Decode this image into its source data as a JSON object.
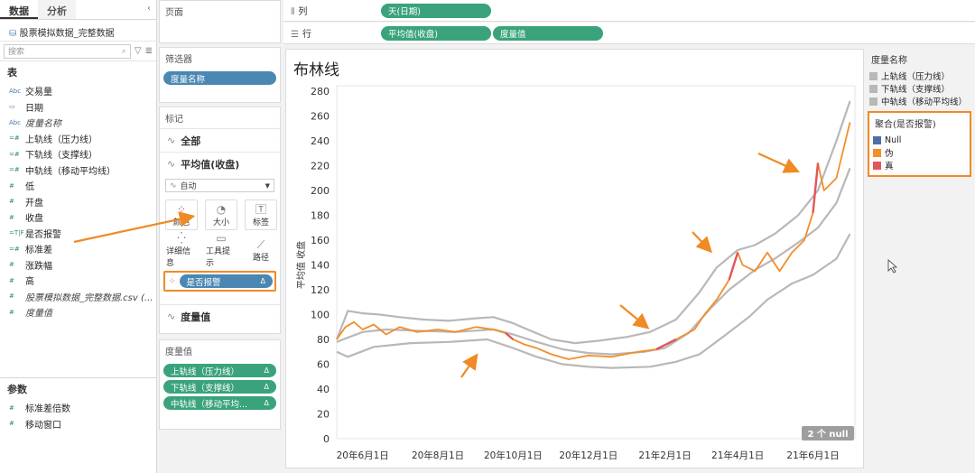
{
  "tabs": {
    "data": "数据",
    "analysis": "分析",
    "collapse": "‹"
  },
  "datasource": "股票模拟数据_完整数据",
  "search": {
    "placeholder": "搜索"
  },
  "tables_title": "表",
  "fields": [
    {
      "type": "Abc",
      "label": "交易量",
      "italic": false
    },
    {
      "type": "▭",
      "label": "日期",
      "italic": false
    },
    {
      "type": "Abc",
      "label": "度量名称",
      "italic": true
    },
    {
      "type": "=#",
      "label": "上轨线（压力线）",
      "italic": false
    },
    {
      "type": "=#",
      "label": "下轨线（支撑线）",
      "italic": false
    },
    {
      "type": "=#",
      "label": "中轨线（移动平均线）",
      "italic": false
    },
    {
      "type": "#",
      "label": "低",
      "italic": false
    },
    {
      "type": "#",
      "label": "开盘",
      "italic": false
    },
    {
      "type": "#",
      "label": "收盘",
      "italic": false
    },
    {
      "type": "=T|F",
      "label": "是否报警",
      "italic": false
    },
    {
      "type": "=#",
      "label": "标准差",
      "italic": false
    },
    {
      "type": "#",
      "label": "涨跌幅",
      "italic": false
    },
    {
      "type": "#",
      "label": "高",
      "italic": false
    },
    {
      "type": "#",
      "label": "股票模拟数据_完整数据.csv (...",
      "italic": true
    },
    {
      "type": "#",
      "label": "度量值",
      "italic": true
    }
  ],
  "params_title": "参数",
  "params": [
    {
      "type": "#",
      "label": "标准差倍数"
    },
    {
      "type": "#",
      "label": "移动窗口"
    }
  ],
  "cards": {
    "pages": "页面",
    "filters": "筛选器",
    "filter_pill": "度量名称",
    "marks": "标记",
    "all": "全部",
    "avg": "平均值(收盘)",
    "mark_type": "自动",
    "buttons": [
      "颜色",
      "大小",
      "标签",
      "详细信息",
      "工具提示",
      "路径"
    ],
    "color_pill": "是否报警",
    "measure_values_row": "度量值",
    "measure_values_title": "度量值",
    "mv_pills": [
      "上轨线（压力线）",
      "下轨线（支撑线）",
      "中轨线（移动平均..."
    ],
    "delta": "Δ"
  },
  "shelves": {
    "columns_label": "列",
    "columns_pills": [
      "天(日期)"
    ],
    "rows_label": "行",
    "rows_pills": [
      "平均值(收盘)",
      "度量值"
    ]
  },
  "sheet_title": "布林线",
  "null_badge": "2 个 null",
  "legends": {
    "measure_title": "度量名称",
    "measure_items": [
      {
        "label": "上轨线（压力线）",
        "color": "#b8b8b8"
      },
      {
        "label": "下轨线（支撑线）",
        "color": "#b8b8b8"
      },
      {
        "label": "中轨线（移动平均线）",
        "color": "#b8b8b8"
      }
    ],
    "alert_title": "聚合(是否报警)",
    "alert_items": [
      {
        "label": "Null",
        "color": "#4e6fa3"
      },
      {
        "label": "伪",
        "color": "#f28e2b"
      },
      {
        "label": "真",
        "color": "#e15759"
      }
    ]
  },
  "chart_data": {
    "type": "line",
    "ylabel": "平均值 收盘",
    "ylim": [
      0,
      280
    ],
    "yticks": [
      0,
      20,
      40,
      60,
      80,
      100,
      120,
      140,
      160,
      180,
      200,
      220,
      240,
      260,
      280
    ],
    "xticks": [
      "20年6月1日",
      "20年8月1日",
      "20年10月1日",
      "20年12月1日",
      "21年2月1日",
      "21年4月1日",
      "21年6月1日"
    ],
    "xlim": [
      "2020-05-11",
      "2021-07-05"
    ],
    "series": [
      {
        "name": "上轨线（压力线）",
        "color": "#b8b8b8",
        "points": [
          [
            "2020-05-11",
            80
          ],
          [
            "2020-05-20",
            103
          ],
          [
            "2020-06-01",
            101
          ],
          [
            "2020-06-15",
            100
          ],
          [
            "2020-07-01",
            98
          ],
          [
            "2020-07-20",
            96
          ],
          [
            "2020-08-10",
            95
          ],
          [
            "2020-09-01",
            97
          ],
          [
            "2020-09-15",
            98
          ],
          [
            "2020-10-01",
            93
          ],
          [
            "2020-10-15",
            87
          ],
          [
            "2020-11-01",
            80
          ],
          [
            "2020-11-20",
            77
          ],
          [
            "2020-12-10",
            79
          ],
          [
            "2021-01-01",
            82
          ],
          [
            "2021-01-20",
            86
          ],
          [
            "2021-02-10",
            96
          ],
          [
            "2021-03-01",
            118
          ],
          [
            "2021-03-15",
            138
          ],
          [
            "2021-04-01",
            152
          ],
          [
            "2021-04-15",
            156
          ],
          [
            "2021-05-01",
            165
          ],
          [
            "2021-05-20",
            180
          ],
          [
            "2021-06-05",
            200
          ],
          [
            "2021-06-20",
            240
          ],
          [
            "2021-07-01",
            272
          ]
        ]
      },
      {
        "name": "中轨线（移动平均线）",
        "color": "#b8b8b8",
        "points": [
          [
            "2020-05-11",
            78
          ],
          [
            "2020-06-01",
            86
          ],
          [
            "2020-06-20",
            88
          ],
          [
            "2020-07-15",
            87
          ],
          [
            "2020-08-15",
            86
          ],
          [
            "2020-09-15",
            88
          ],
          [
            "2020-10-01",
            84
          ],
          [
            "2020-10-20",
            78
          ],
          [
            "2020-11-10",
            72
          ],
          [
            "2020-12-01",
            69
          ],
          [
            "2020-12-20",
            68
          ],
          [
            "2021-01-15",
            70
          ],
          [
            "2021-02-01",
            73
          ],
          [
            "2021-02-20",
            85
          ],
          [
            "2021-03-10",
            105
          ],
          [
            "2021-03-25",
            120
          ],
          [
            "2021-04-15",
            136
          ],
          [
            "2021-05-01",
            145
          ],
          [
            "2021-05-20",
            158
          ],
          [
            "2021-06-05",
            170
          ],
          [
            "2021-06-20",
            190
          ],
          [
            "2021-07-01",
            218
          ]
        ]
      },
      {
        "name": "下轨线（支撑线）",
        "color": "#b8b8b8",
        "points": [
          [
            "2020-05-11",
            70
          ],
          [
            "2020-05-20",
            66
          ],
          [
            "2020-06-10",
            74
          ],
          [
            "2020-07-10",
            77
          ],
          [
            "2020-08-10",
            78
          ],
          [
            "2020-09-10",
            80
          ],
          [
            "2020-10-01",
            73
          ],
          [
            "2020-10-20",
            66
          ],
          [
            "2020-11-10",
            60
          ],
          [
            "2020-12-01",
            58
          ],
          [
            "2020-12-20",
            57
          ],
          [
            "2021-01-20",
            58
          ],
          [
            "2021-02-10",
            62
          ],
          [
            "2021-03-01",
            68
          ],
          [
            "2021-03-20",
            82
          ],
          [
            "2021-04-10",
            98
          ],
          [
            "2021-04-25",
            112
          ],
          [
            "2021-05-15",
            125
          ],
          [
            "2021-06-01",
            132
          ],
          [
            "2021-06-20",
            145
          ],
          [
            "2021-07-01",
            165
          ]
        ]
      },
      {
        "name": "平均值(收盘)",
        "color": "#f28e2b",
        "points": [
          [
            "2020-05-11",
            80
          ],
          [
            "2020-05-18",
            90
          ],
          [
            "2020-05-25",
            94
          ],
          [
            "2020-06-01",
            88
          ],
          [
            "2020-06-10",
            92
          ],
          [
            "2020-06-20",
            84
          ],
          [
            "2020-07-01",
            90
          ],
          [
            "2020-07-15",
            86
          ],
          [
            "2020-08-01",
            88
          ],
          [
            "2020-08-15",
            86
          ],
          [
            "2020-09-01",
            90
          ],
          [
            "2020-09-15",
            88
          ],
          [
            "2020-09-25",
            85
          ],
          [
            "2020-10-01",
            80
          ],
          [
            "2020-10-10",
            76
          ],
          [
            "2020-10-20",
            73
          ],
          [
            "2020-11-01",
            68
          ],
          [
            "2020-11-15",
            64
          ],
          [
            "2020-12-01",
            67
          ],
          [
            "2020-12-20",
            66
          ],
          [
            "2021-01-10",
            70
          ],
          [
            "2021-01-25",
            72
          ],
          [
            "2021-02-10",
            80
          ],
          [
            "2021-02-25",
            88
          ],
          [
            "2021-03-05",
            100
          ],
          [
            "2021-03-15",
            112
          ],
          [
            "2021-03-25",
            128
          ],
          [
            "2021-04-01",
            150
          ],
          [
            "2021-04-05",
            140
          ],
          [
            "2021-04-15",
            135
          ],
          [
            "2021-04-25",
            150
          ],
          [
            "2021-05-05",
            135
          ],
          [
            "2021-05-15",
            150
          ],
          [
            "2021-05-25",
            160
          ],
          [
            "2021-06-01",
            182
          ],
          [
            "2021-06-05",
            222
          ],
          [
            "2021-06-10",
            200
          ],
          [
            "2021-06-20",
            210
          ],
          [
            "2021-07-01",
            255
          ]
        ]
      }
    ],
    "alert_points": [
      "2020-10-01",
      "2021-02-10",
      "2021-04-01",
      "2021-06-05"
    ]
  }
}
